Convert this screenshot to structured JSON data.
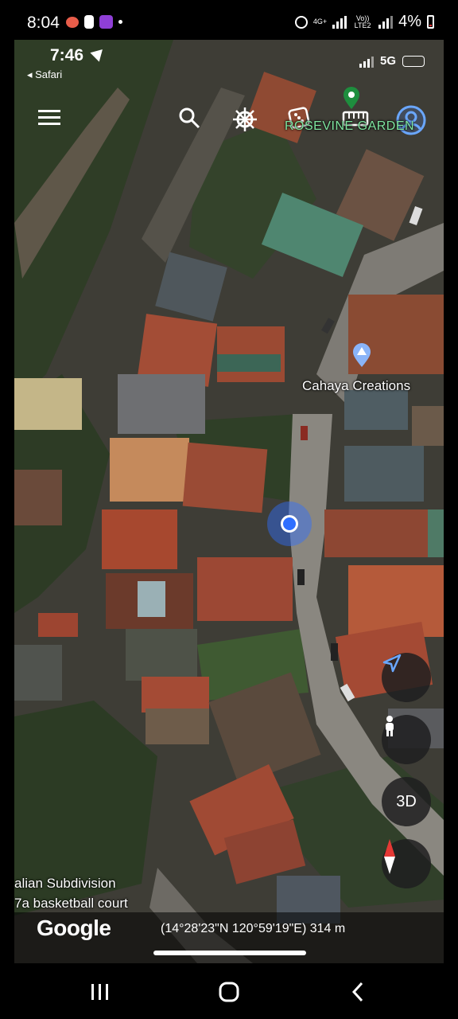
{
  "android_status": {
    "time": "8:04",
    "network_top": "4G+",
    "network_volte": "Vo)) LTE2",
    "battery": "4%"
  },
  "ios_status": {
    "time": "7:46",
    "back_label": "◂ Safari",
    "network": "5G"
  },
  "top_bar": {
    "menu_icon": "hamburger-menu-icon",
    "search_icon": "search-icon",
    "voyager_icon": "ship-wheel-icon",
    "dice_icon": "dice-icon",
    "measure_icon": "ruler-icon",
    "profile_icon": "user-profile-icon"
  },
  "map": {
    "labels": {
      "rosevine": "ROSEVINE GARDEN",
      "cahaya": "Cahaya Creations",
      "subdivision": "alian Subdivision",
      "basketball": "7a basketball court"
    },
    "location_color": "#2f6fff"
  },
  "controls": {
    "navigate_icon": "navigation-arrow-icon",
    "pegman_icon": "pegman-icon",
    "view_3d": "3D",
    "compass_icon": "compass-icon"
  },
  "footer": {
    "logo": "Google",
    "coordinates": "(14°28'23\"N 120°59'19\"E) 314 m"
  },
  "android_nav": {
    "recents_icon": "recents-icon",
    "home_icon": "home-icon",
    "back_icon": "back-icon"
  }
}
